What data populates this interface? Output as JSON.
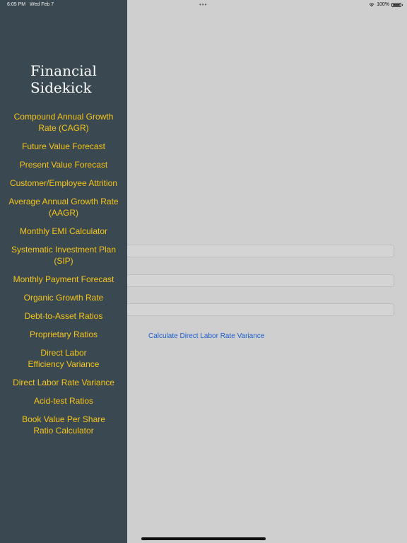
{
  "status_bar": {
    "time": "6:05 PM",
    "date": "Wed Feb 7",
    "dots": "•••",
    "battery": "100%"
  },
  "sidebar": {
    "title": "Financial Sidekick",
    "items": [
      {
        "label": "Compound Annual Growth\nRate (CAGR)"
      },
      {
        "label": "Future Value Forecast"
      },
      {
        "label": "Present Value Forecast"
      },
      {
        "label": "Customer/Employee Attrition"
      },
      {
        "label": "Average Annual Growth Rate\n(AAGR)"
      },
      {
        "label": "Monthly EMI Calculator"
      },
      {
        "label": "Systematic Investment Plan\n(SIP)"
      },
      {
        "label": "Monthly Payment Forecast"
      },
      {
        "label": "Organic Growth Rate"
      },
      {
        "label": "Debt-to-Asset Ratios"
      },
      {
        "label": "Proprietary Ratios"
      },
      {
        "label": "Direct Labor\nEfficiency Variance"
      },
      {
        "label": "Direct Labor Rate Variance"
      },
      {
        "label": "Acid-test Ratios"
      },
      {
        "label": "Book Value Per Share\nRatio Calculator"
      }
    ]
  },
  "main": {
    "calculate_label": "Calculate Direct Labor Rate Variance"
  },
  "colors": {
    "sidebar_bg": "#3a4852",
    "menu_text": "#f5c518",
    "link": "#1a5fd0",
    "background": "#cfcfcf"
  }
}
